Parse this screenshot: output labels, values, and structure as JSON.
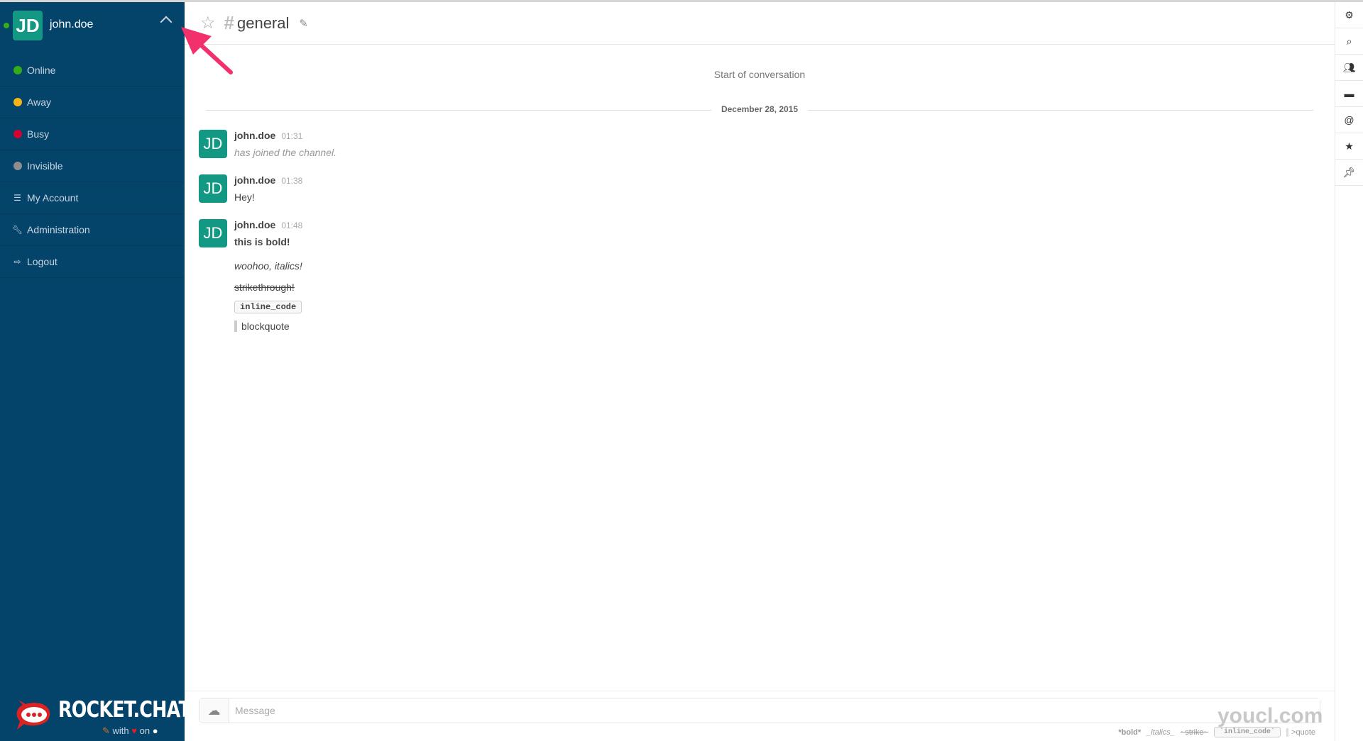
{
  "user": {
    "initials": "JD",
    "name": "john.doe",
    "status_color": "#35ac19"
  },
  "menu": [
    {
      "label": "Online",
      "icon": "status-dot",
      "color": "#35ac19"
    },
    {
      "label": "Away",
      "icon": "status-dot",
      "color": "#fcb316"
    },
    {
      "label": "Busy",
      "icon": "status-dot",
      "color": "#d30230"
    },
    {
      "label": "Invisible",
      "icon": "status-dot",
      "color": "#8e8e8e"
    },
    {
      "label": "My Account",
      "icon": "sliders-icon"
    },
    {
      "label": "Administration",
      "icon": "wrench-icon"
    },
    {
      "label": "Logout",
      "icon": "logout-icon"
    }
  ],
  "logo": {
    "text": "ROCKET.CHAT",
    "with": "with",
    "on": "on"
  },
  "channel": {
    "name": "general"
  },
  "conversation": {
    "start": "Start of conversation",
    "date": "December 28, 2015"
  },
  "messages": [
    {
      "initials": "JD",
      "user": "john.doe",
      "time": "01:31",
      "text": "has joined the channel."
    },
    {
      "initials": "JD",
      "user": "john.doe",
      "time": "01:38",
      "text": "Hey!"
    },
    {
      "initials": "JD",
      "user": "john.doe",
      "time": "01:48",
      "bold": "this is bold!",
      "italic": "woohoo, italics!",
      "strike": "strikethrough!",
      "code": "inline_code",
      "quote": "blockquote"
    }
  ],
  "composer": {
    "placeholder": "Message"
  },
  "hints": {
    "bold": "*bold*",
    "italics": "_italics_",
    "strike": "~strike~",
    "code": "`inline_code`",
    "quote": ">quote"
  },
  "rightbar": [
    "gear-icon",
    "search-icon",
    "members-icon",
    "files-icon",
    "mention-icon",
    "star-icon",
    "pin-icon"
  ],
  "watermark": "youcl.com",
  "accent": "#129883",
  "sidebar_bg": "#04436a"
}
